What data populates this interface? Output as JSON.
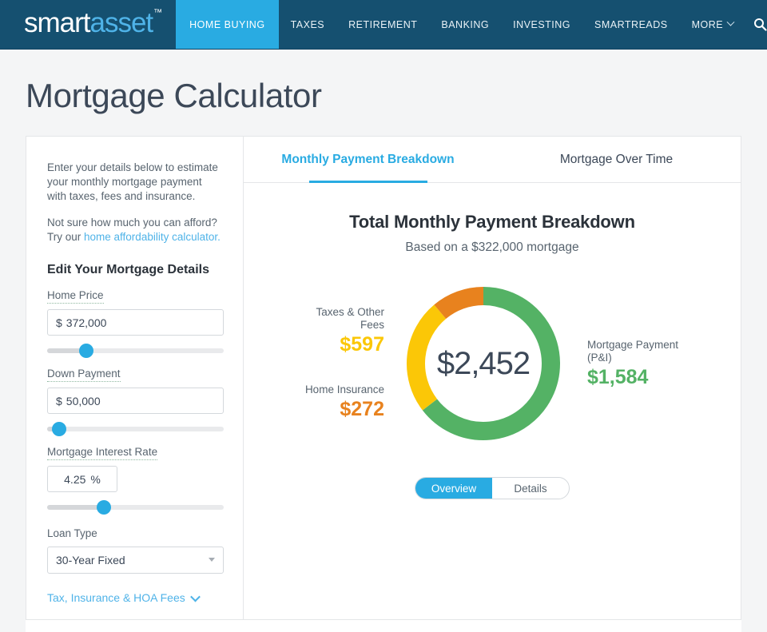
{
  "nav": {
    "logo": {
      "part1": "smart",
      "part2": "asset",
      "tm": "™"
    },
    "items": [
      {
        "label": "HOME BUYING",
        "active": true
      },
      {
        "label": "TAXES",
        "active": false
      },
      {
        "label": "RETIREMENT",
        "active": false
      },
      {
        "label": "BANKING",
        "active": false
      },
      {
        "label": "INVESTING",
        "active": false
      },
      {
        "label": "SMARTREADS",
        "active": false
      },
      {
        "label": "MORE",
        "active": false,
        "caret": true
      }
    ],
    "search_icon": "search-icon"
  },
  "page": {
    "title": "Mortgage Calculator"
  },
  "sidebar": {
    "intro_1": "Enter your details below to estimate your monthly mortgage payment with taxes, fees and insurance.",
    "intro_2_pre": "Not sure how much you can afford? Try our ",
    "intro_2_link": "home affordability calculator.",
    "section_title": "Edit Your Mortgage Details",
    "fields": [
      {
        "label": "Home Price",
        "currency": "$",
        "value": "372,000",
        "slider_pct": 22
      },
      {
        "label": "Down Payment",
        "currency": "$",
        "value": "50,000",
        "slider_pct": 7
      },
      {
        "label": "Mortgage Interest Rate",
        "value": "4.25",
        "unit": "%",
        "slider_pct": 32
      }
    ],
    "loan_type": {
      "label": "Loan Type",
      "value": "30-Year Fixed"
    },
    "hoa_link": "Tax, Insurance & HOA Fees"
  },
  "tabs": [
    {
      "label": "Monthly Payment Breakdown",
      "active": true
    },
    {
      "label": "Mortgage Over Time",
      "active": false
    }
  ],
  "chart_data": {
    "type": "pie",
    "title": "Total Monthly Payment Breakdown",
    "subtitle": "Based on a $322,000 mortgage",
    "center_label": "$2,452",
    "total": 2452,
    "categories": [
      "Mortgage Payment (P&I)",
      "Taxes & Other Fees",
      "Home Insurance"
    ],
    "values": [
      1584,
      597,
      272
    ],
    "value_labels": [
      "$1,584",
      "$597",
      "$272"
    ],
    "colors": [
      "#54b265",
      "#fbc707",
      "#e8821e"
    ],
    "start_angle_deg": 0,
    "direction": "clockwise",
    "donut_hole_ratio": 0.78,
    "legend_position": "sides",
    "grid": false
  },
  "toggle": {
    "options": [
      {
        "label": "Overview",
        "active": true
      },
      {
        "label": "Details",
        "active": false
      }
    ]
  }
}
